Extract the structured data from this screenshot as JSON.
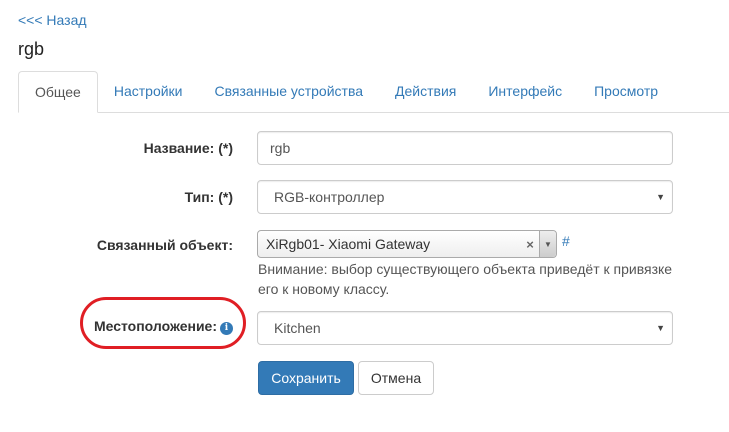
{
  "nav": {
    "back_label": "<<< Назад"
  },
  "header": {
    "title": "rgb"
  },
  "tabs": [
    {
      "label": "Общее",
      "active": true
    },
    {
      "label": "Настройки",
      "active": false
    },
    {
      "label": "Связанные устройства",
      "active": false
    },
    {
      "label": "Действия",
      "active": false
    },
    {
      "label": "Интерфейс",
      "active": false
    },
    {
      "label": "Просмотр",
      "active": false
    }
  ],
  "form": {
    "name": {
      "label": "Название: (*)",
      "value": "rgb"
    },
    "type": {
      "label": "Тип: (*)",
      "value": "RGB-контроллер"
    },
    "linked_object": {
      "label": "Связанный объект:",
      "value": "XiRgb01- Xiaomi Gateway",
      "clear": "×",
      "hash_link": "#",
      "hint": "Внимание: выбор существующего объекта приведёт к привязке его к новому классу."
    },
    "location": {
      "label": "Местоположение:",
      "value": "Kitchen",
      "info_icon": "i"
    }
  },
  "buttons": {
    "save": "Сохранить",
    "cancel": "Отмена"
  },
  "icons": {
    "select_caret": "▼",
    "info": "info-icon",
    "clear": "clear-icon",
    "dropdown": "chevron-down-icon"
  },
  "colors": {
    "link": "#337ab7",
    "primary": "#337ab7",
    "highlight": "#e01e24"
  }
}
